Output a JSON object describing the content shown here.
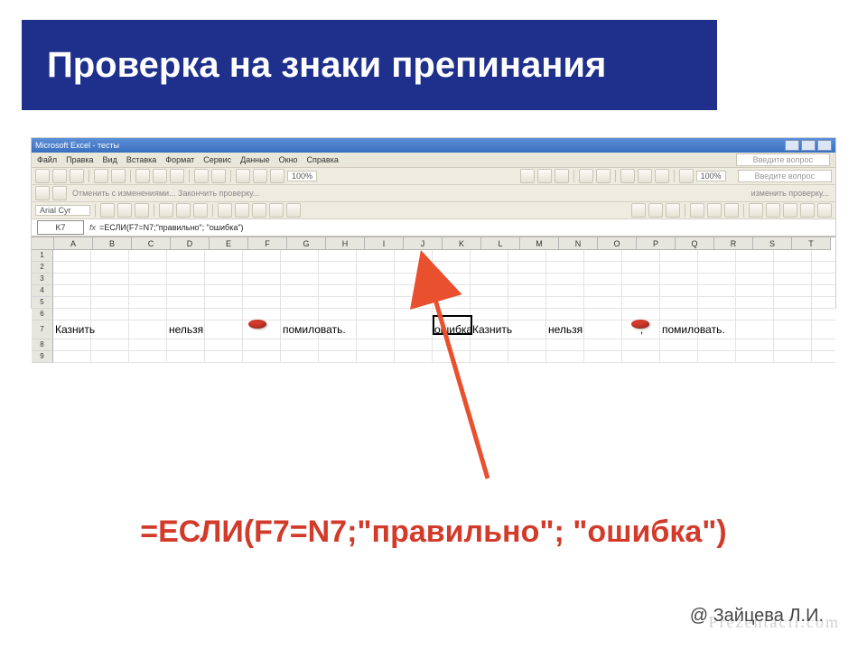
{
  "slide": {
    "title": "Проверка на знаки препинания",
    "footer_formula": "=ЕСЛИ(F7=N7;\"правильно\"; \"ошибка\")",
    "credit": "@ Зайцева Л.И."
  },
  "excel": {
    "app_title": "Microsoft Excel - тесты",
    "menu": [
      "Файл",
      "Правка",
      "Вид",
      "Вставка",
      "Формат",
      "Сервис",
      "Данные",
      "Окно",
      "Справка"
    ],
    "help_box": "Введите вопрос",
    "toolbar_hint_left": "Отменить с изменениями... Закончить проверку...",
    "toolbar_hint_right": "изменить проверку...",
    "zoom": "100%",
    "font_name": "Arial Cyr",
    "name_box": "K7",
    "formula_bar": "=ЕСЛИ(F7=N7;\"правильно\"; \"ошибка\")",
    "columns": [
      "A",
      "B",
      "C",
      "D",
      "E",
      "F",
      "G",
      "H",
      "I",
      "J",
      "K",
      "L",
      "M",
      "N",
      "O",
      "P",
      "Q",
      "R",
      "S",
      "T"
    ],
    "row_numbers": [
      "1",
      "2",
      "3",
      "4",
      "5",
      "6",
      "7",
      "8",
      "9"
    ],
    "row7": {
      "A": "Казнить",
      "D": "нельзя",
      "G": "помиловать.",
      "K": "ошибка",
      "L": "Казнить",
      "N": "нельзя",
      "P": ",",
      "Q": "помиловать."
    },
    "active_cell": "K7"
  },
  "watermark": "Prezentacii.com"
}
